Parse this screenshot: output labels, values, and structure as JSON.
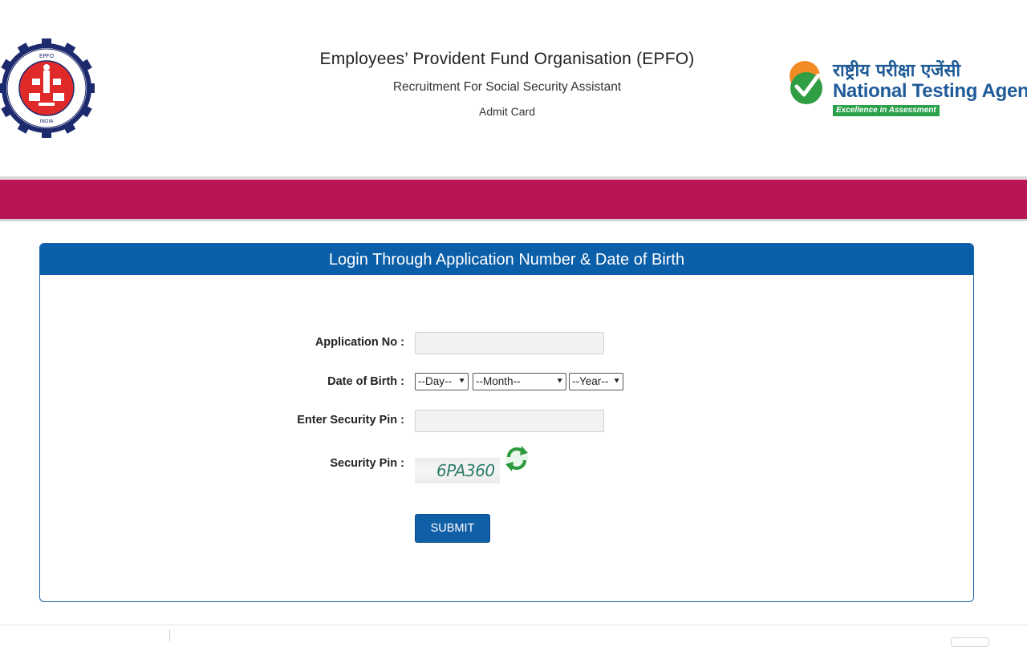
{
  "header": {
    "org_name": "Employees’ Provident Fund Organisation (EPFO)",
    "subtitle": "Recruitment For Social Security Assistant",
    "page_name": "Admit Card",
    "epfo_logo_text": "EMPLOYEES' PROVIDENT FUND ORGANISATION INDIA भारत",
    "nta": {
      "hindi": "राष्ट्रीय परीक्षा एजेंसी",
      "english": "National Testing Agency",
      "tagline": "Excellence in Assessment"
    }
  },
  "login": {
    "title": "Login Through Application Number & Date of Birth",
    "application_no_label": "Application No :",
    "application_no_value": "",
    "dob_label": "Date of Birth :",
    "day_select": "--Day--",
    "month_select": "--Month--",
    "year_select": "--Year--",
    "security_pin_input_label": "Enter Security Pin :",
    "security_pin_input_value": "",
    "security_pin_label": "Security Pin :",
    "captcha_text": "6PA360",
    "submit_label": "SUBMIT"
  },
  "colors": {
    "band": "#b81556",
    "panel_header": "#0b5ea8",
    "submit": "#115fa6"
  },
  "icons": [
    "epfo-logo",
    "nta-logo",
    "refresh-icon",
    "chevron-down-icon"
  ]
}
